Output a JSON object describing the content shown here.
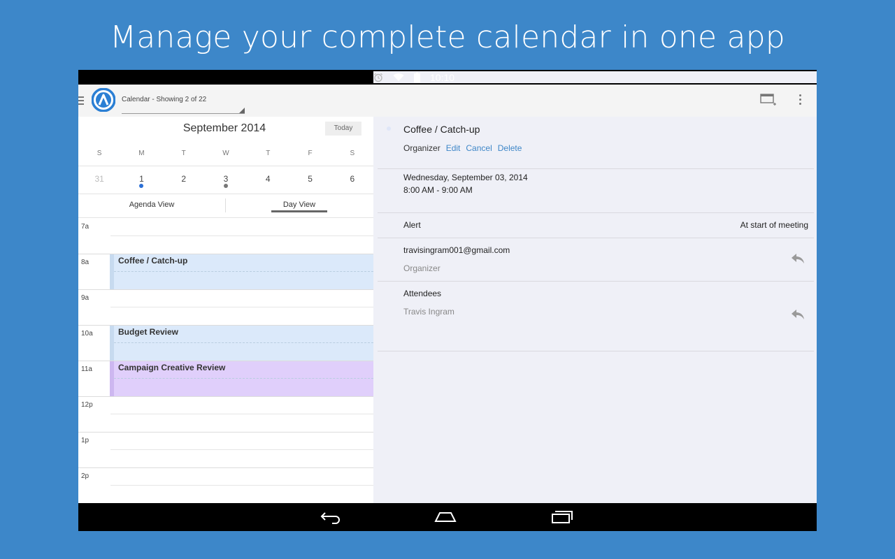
{
  "headline": "Manage your complete calendar in one app",
  "status_bar": {
    "time": "10:10",
    "icons": [
      "alarm-icon",
      "wifi-icon",
      "battery-icon"
    ]
  },
  "app_bar": {
    "calendar_selector": "Calendar - Showing 2 of 22",
    "icons": [
      "hamburger-icon",
      "app-logo-icon",
      "add-window-icon",
      "overflow-menu-icon"
    ]
  },
  "calendar": {
    "month_title": "September 2014",
    "today_button": "Today",
    "weekdays": [
      "S",
      "M",
      "T",
      "W",
      "T",
      "F",
      "S"
    ],
    "days": [
      {
        "label": "31",
        "muted": true,
        "dot": ""
      },
      {
        "label": "1",
        "muted": false,
        "dot": "#2b6fd6"
      },
      {
        "label": "2",
        "muted": false,
        "dot": ""
      },
      {
        "label": "3",
        "muted": false,
        "dot": "#777777"
      },
      {
        "label": "4",
        "muted": false,
        "dot": ""
      },
      {
        "label": "5",
        "muted": false,
        "dot": ""
      },
      {
        "label": "6",
        "muted": false,
        "dot": ""
      }
    ],
    "view_tabs": {
      "agenda": "Agenda View",
      "day": "Day View",
      "selected": "day"
    },
    "hours": [
      {
        "label": "7a",
        "event": null
      },
      {
        "label": "8a",
        "event": {
          "title": "Coffee / Catch-up",
          "color": "#dbe9fa",
          "bar": "#c7daef"
        }
      },
      {
        "label": "9a",
        "event": null
      },
      {
        "label": "10a",
        "event": {
          "title": "Budget Review",
          "color": "#dbe9fa",
          "bar": "#c7daef"
        }
      },
      {
        "label": "11a",
        "event": {
          "title": "Campaign Creative Review",
          "color": "#e0cffb",
          "bar": "#cdb7f0"
        }
      },
      {
        "label": "12p",
        "event": null
      },
      {
        "label": "1p",
        "event": null
      },
      {
        "label": "2p",
        "event": null
      }
    ]
  },
  "event_detail": {
    "title": "Coffee / Catch-up",
    "role": "Organizer",
    "actions": {
      "edit": "Edit",
      "cancel": "Cancel",
      "delete": "Delete"
    },
    "date": "Wednesday, September 03, 2014",
    "time": "8:00 AM - 9:00 AM",
    "alert_label": "Alert",
    "alert_value": "At start of meeting",
    "organizer_email": "travisingram001@gmail.com",
    "organizer_role": "Organizer",
    "attendees_label": "Attendees",
    "attendee": "Travis Ingram"
  },
  "nav_bar": {
    "icons": [
      "back-icon",
      "home-icon",
      "recents-icon"
    ]
  }
}
